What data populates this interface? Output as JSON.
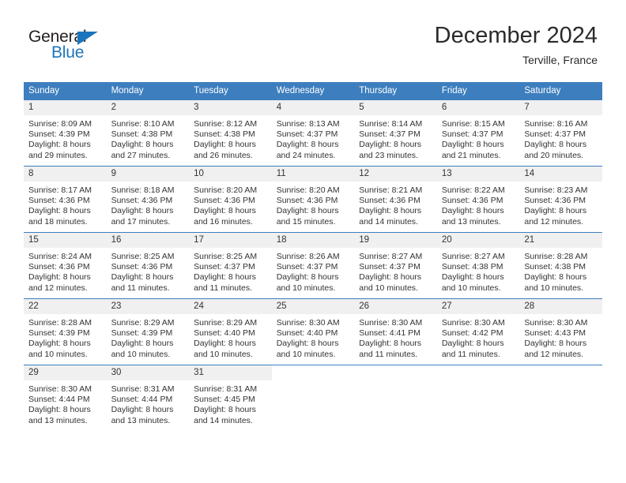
{
  "brand": {
    "name_top": "General",
    "name_bottom": "Blue",
    "triangle_color": "#1b75bc",
    "text_color": "#231f20"
  },
  "header": {
    "title": "December 2024",
    "subtitle": "Terville, France"
  },
  "theme": {
    "header_blue": "#3d7ebe",
    "daynum_bg": "#f0f0f0",
    "text": "#333333"
  },
  "weekday_headers": [
    "Sunday",
    "Monday",
    "Tuesday",
    "Wednesday",
    "Thursday",
    "Friday",
    "Saturday"
  ],
  "weeks": [
    [
      {
        "day": "1",
        "sunrise": "Sunrise: 8:09 AM",
        "sunset": "Sunset: 4:39 PM",
        "daylight1": "Daylight: 8 hours",
        "daylight2": "and 29 minutes."
      },
      {
        "day": "2",
        "sunrise": "Sunrise: 8:10 AM",
        "sunset": "Sunset: 4:38 PM",
        "daylight1": "Daylight: 8 hours",
        "daylight2": "and 27 minutes."
      },
      {
        "day": "3",
        "sunrise": "Sunrise: 8:12 AM",
        "sunset": "Sunset: 4:38 PM",
        "daylight1": "Daylight: 8 hours",
        "daylight2": "and 26 minutes."
      },
      {
        "day": "4",
        "sunrise": "Sunrise: 8:13 AM",
        "sunset": "Sunset: 4:37 PM",
        "daylight1": "Daylight: 8 hours",
        "daylight2": "and 24 minutes."
      },
      {
        "day": "5",
        "sunrise": "Sunrise: 8:14 AM",
        "sunset": "Sunset: 4:37 PM",
        "daylight1": "Daylight: 8 hours",
        "daylight2": "and 23 minutes."
      },
      {
        "day": "6",
        "sunrise": "Sunrise: 8:15 AM",
        "sunset": "Sunset: 4:37 PM",
        "daylight1": "Daylight: 8 hours",
        "daylight2": "and 21 minutes."
      },
      {
        "day": "7",
        "sunrise": "Sunrise: 8:16 AM",
        "sunset": "Sunset: 4:37 PM",
        "daylight1": "Daylight: 8 hours",
        "daylight2": "and 20 minutes."
      }
    ],
    [
      {
        "day": "8",
        "sunrise": "Sunrise: 8:17 AM",
        "sunset": "Sunset: 4:36 PM",
        "daylight1": "Daylight: 8 hours",
        "daylight2": "and 18 minutes."
      },
      {
        "day": "9",
        "sunrise": "Sunrise: 8:18 AM",
        "sunset": "Sunset: 4:36 PM",
        "daylight1": "Daylight: 8 hours",
        "daylight2": "and 17 minutes."
      },
      {
        "day": "10",
        "sunrise": "Sunrise: 8:20 AM",
        "sunset": "Sunset: 4:36 PM",
        "daylight1": "Daylight: 8 hours",
        "daylight2": "and 16 minutes."
      },
      {
        "day": "11",
        "sunrise": "Sunrise: 8:20 AM",
        "sunset": "Sunset: 4:36 PM",
        "daylight1": "Daylight: 8 hours",
        "daylight2": "and 15 minutes."
      },
      {
        "day": "12",
        "sunrise": "Sunrise: 8:21 AM",
        "sunset": "Sunset: 4:36 PM",
        "daylight1": "Daylight: 8 hours",
        "daylight2": "and 14 minutes."
      },
      {
        "day": "13",
        "sunrise": "Sunrise: 8:22 AM",
        "sunset": "Sunset: 4:36 PM",
        "daylight1": "Daylight: 8 hours",
        "daylight2": "and 13 minutes."
      },
      {
        "day": "14",
        "sunrise": "Sunrise: 8:23 AM",
        "sunset": "Sunset: 4:36 PM",
        "daylight1": "Daylight: 8 hours",
        "daylight2": "and 12 minutes."
      }
    ],
    [
      {
        "day": "15",
        "sunrise": "Sunrise: 8:24 AM",
        "sunset": "Sunset: 4:36 PM",
        "daylight1": "Daylight: 8 hours",
        "daylight2": "and 12 minutes."
      },
      {
        "day": "16",
        "sunrise": "Sunrise: 8:25 AM",
        "sunset": "Sunset: 4:36 PM",
        "daylight1": "Daylight: 8 hours",
        "daylight2": "and 11 minutes."
      },
      {
        "day": "17",
        "sunrise": "Sunrise: 8:25 AM",
        "sunset": "Sunset: 4:37 PM",
        "daylight1": "Daylight: 8 hours",
        "daylight2": "and 11 minutes."
      },
      {
        "day": "18",
        "sunrise": "Sunrise: 8:26 AM",
        "sunset": "Sunset: 4:37 PM",
        "daylight1": "Daylight: 8 hours",
        "daylight2": "and 10 minutes."
      },
      {
        "day": "19",
        "sunrise": "Sunrise: 8:27 AM",
        "sunset": "Sunset: 4:37 PM",
        "daylight1": "Daylight: 8 hours",
        "daylight2": "and 10 minutes."
      },
      {
        "day": "20",
        "sunrise": "Sunrise: 8:27 AM",
        "sunset": "Sunset: 4:38 PM",
        "daylight1": "Daylight: 8 hours",
        "daylight2": "and 10 minutes."
      },
      {
        "day": "21",
        "sunrise": "Sunrise: 8:28 AM",
        "sunset": "Sunset: 4:38 PM",
        "daylight1": "Daylight: 8 hours",
        "daylight2": "and 10 minutes."
      }
    ],
    [
      {
        "day": "22",
        "sunrise": "Sunrise: 8:28 AM",
        "sunset": "Sunset: 4:39 PM",
        "daylight1": "Daylight: 8 hours",
        "daylight2": "and 10 minutes."
      },
      {
        "day": "23",
        "sunrise": "Sunrise: 8:29 AM",
        "sunset": "Sunset: 4:39 PM",
        "daylight1": "Daylight: 8 hours",
        "daylight2": "and 10 minutes."
      },
      {
        "day": "24",
        "sunrise": "Sunrise: 8:29 AM",
        "sunset": "Sunset: 4:40 PM",
        "daylight1": "Daylight: 8 hours",
        "daylight2": "and 10 minutes."
      },
      {
        "day": "25",
        "sunrise": "Sunrise: 8:30 AM",
        "sunset": "Sunset: 4:40 PM",
        "daylight1": "Daylight: 8 hours",
        "daylight2": "and 10 minutes."
      },
      {
        "day": "26",
        "sunrise": "Sunrise: 8:30 AM",
        "sunset": "Sunset: 4:41 PM",
        "daylight1": "Daylight: 8 hours",
        "daylight2": "and 11 minutes."
      },
      {
        "day": "27",
        "sunrise": "Sunrise: 8:30 AM",
        "sunset": "Sunset: 4:42 PM",
        "daylight1": "Daylight: 8 hours",
        "daylight2": "and 11 minutes."
      },
      {
        "day": "28",
        "sunrise": "Sunrise: 8:30 AM",
        "sunset": "Sunset: 4:43 PM",
        "daylight1": "Daylight: 8 hours",
        "daylight2": "and 12 minutes."
      }
    ],
    [
      {
        "day": "29",
        "sunrise": "Sunrise: 8:30 AM",
        "sunset": "Sunset: 4:44 PM",
        "daylight1": "Daylight: 8 hours",
        "daylight2": "and 13 minutes."
      },
      {
        "day": "30",
        "sunrise": "Sunrise: 8:31 AM",
        "sunset": "Sunset: 4:44 PM",
        "daylight1": "Daylight: 8 hours",
        "daylight2": "and 13 minutes."
      },
      {
        "day": "31",
        "sunrise": "Sunrise: 8:31 AM",
        "sunset": "Sunset: 4:45 PM",
        "daylight1": "Daylight: 8 hours",
        "daylight2": "and 14 minutes."
      },
      {
        "day": "",
        "sunrise": "",
        "sunset": "",
        "daylight1": "",
        "daylight2": ""
      },
      {
        "day": "",
        "sunrise": "",
        "sunset": "",
        "daylight1": "",
        "daylight2": ""
      },
      {
        "day": "",
        "sunrise": "",
        "sunset": "",
        "daylight1": "",
        "daylight2": ""
      },
      {
        "day": "",
        "sunrise": "",
        "sunset": "",
        "daylight1": "",
        "daylight2": ""
      }
    ]
  ]
}
